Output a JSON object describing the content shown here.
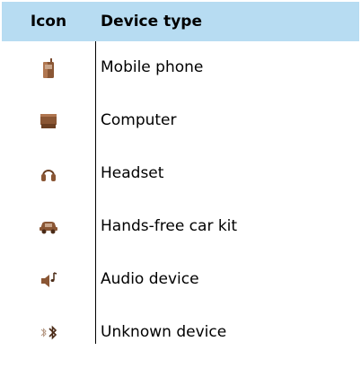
{
  "table": {
    "header": {
      "icon_col": "Icon",
      "type_col": "Device type"
    },
    "header_bg": "#b7dcf2",
    "icon_color": "#7a4a2e",
    "rows": [
      {
        "icon": "mobile-phone-icon",
        "label": "Mobile phone"
      },
      {
        "icon": "computer-icon",
        "label": "Computer"
      },
      {
        "icon": "headset-icon",
        "label": "Headset"
      },
      {
        "icon": "car-kit-icon",
        "label": "Hands-free car kit"
      },
      {
        "icon": "audio-device-icon",
        "label": "Audio device"
      },
      {
        "icon": "bluetooth-unknown-icon",
        "label": "Unknown device"
      }
    ]
  }
}
